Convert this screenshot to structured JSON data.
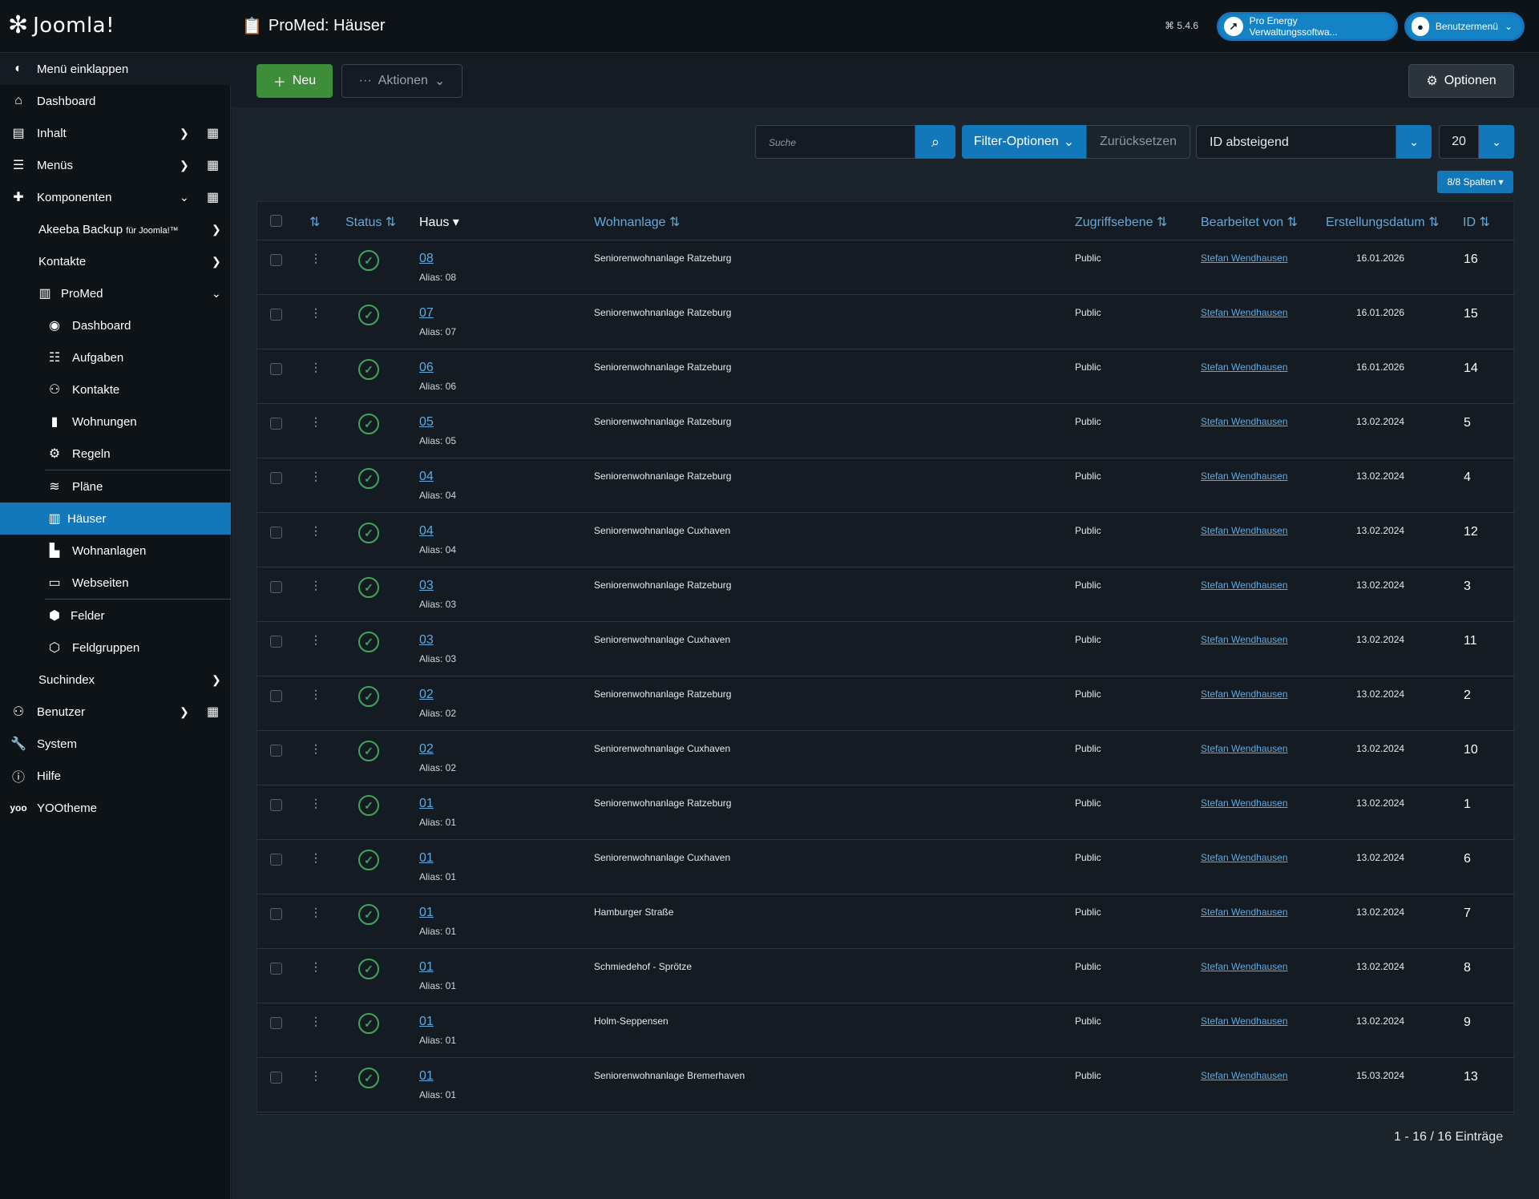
{
  "header": {
    "logo_text": "Joomla!",
    "title": "ProMed: Häuser",
    "version": "⌘ 5.4.6",
    "site_link": "Pro Energy Verwaltungssoftwa...",
    "user_menu": "Benutzermenü"
  },
  "sidebar": {
    "collapse": "Menü einklappen",
    "dashboard": "Dashboard",
    "inhalt": "Inhalt",
    "menus": "Menüs",
    "komponenten": "Komponenten",
    "akeeba": "Akeeba Backup",
    "akeeba_suffix": "für Joomla!™",
    "kontakte": "Kontakte",
    "promed": "ProMed",
    "pm_dashboard": "Dashboard",
    "pm_aufgaben": "Aufgaben",
    "pm_kontakte": "Kontakte",
    "pm_wohnungen": "Wohnungen",
    "pm_regeln": "Regeln",
    "pm_plaene": "Pläne",
    "pm_haeuser": "Häuser",
    "pm_wohnanlagen": "Wohnanlagen",
    "pm_webseiten": "Webseiten",
    "pm_felder": "Felder",
    "pm_feldgruppen": "Feldgruppen",
    "suchindex": "Suchindex",
    "benutzer": "Benutzer",
    "system": "System",
    "hilfe": "Hilfe",
    "yootheme": "YOOtheme"
  },
  "toolbar": {
    "new": "Neu",
    "actions": "Aktionen",
    "options": "Optionen"
  },
  "filters": {
    "search_placeholder": "Suche",
    "filter_options": "Filter-Optionen",
    "reset": "Zurücksetzen",
    "sort": "ID absteigend",
    "limit": "20",
    "columns": "8/8 Spalten"
  },
  "table": {
    "headers": {
      "status": "Status",
      "haus": "Haus",
      "wohnanlage": "Wohnanlage",
      "zugriff": "Zugriffsebene",
      "bearbeitet": "Bearbeitet von",
      "datum": "Erstellungsdatum",
      "id": "ID"
    },
    "rows": [
      {
        "haus": "08",
        "alias": "Alias: 08",
        "wohnanlage": "Seniorenwohnanlage Ratzeburg",
        "zugriff": "Public",
        "autor": "Stefan Wendhausen",
        "datum": "16.01.2026",
        "id": "16"
      },
      {
        "haus": "07",
        "alias": "Alias: 07",
        "wohnanlage": "Seniorenwohnanlage Ratzeburg",
        "zugriff": "Public",
        "autor": "Stefan Wendhausen",
        "datum": "16.01.2026",
        "id": "15"
      },
      {
        "haus": "06",
        "alias": "Alias: 06",
        "wohnanlage": "Seniorenwohnanlage Ratzeburg",
        "zugriff": "Public",
        "autor": "Stefan Wendhausen",
        "datum": "16.01.2026",
        "id": "14"
      },
      {
        "haus": "05",
        "alias": "Alias: 05",
        "wohnanlage": "Seniorenwohnanlage Ratzeburg",
        "zugriff": "Public",
        "autor": "Stefan Wendhausen",
        "datum": "13.02.2024",
        "id": "5"
      },
      {
        "haus": "04",
        "alias": "Alias: 04",
        "wohnanlage": "Seniorenwohnanlage Ratzeburg",
        "zugriff": "Public",
        "autor": "Stefan Wendhausen",
        "datum": "13.02.2024",
        "id": "4"
      },
      {
        "haus": "04",
        "alias": "Alias: 04",
        "wohnanlage": "Seniorenwohnanlage Cuxhaven",
        "zugriff": "Public",
        "autor": "Stefan Wendhausen",
        "datum": "13.02.2024",
        "id": "12"
      },
      {
        "haus": "03",
        "alias": "Alias: 03",
        "wohnanlage": "Seniorenwohnanlage Ratzeburg",
        "zugriff": "Public",
        "autor": "Stefan Wendhausen",
        "datum": "13.02.2024",
        "id": "3"
      },
      {
        "haus": "03",
        "alias": "Alias: 03",
        "wohnanlage": "Seniorenwohnanlage Cuxhaven",
        "zugriff": "Public",
        "autor": "Stefan Wendhausen",
        "datum": "13.02.2024",
        "id": "11"
      },
      {
        "haus": "02",
        "alias": "Alias: 02",
        "wohnanlage": "Seniorenwohnanlage Ratzeburg",
        "zugriff": "Public",
        "autor": "Stefan Wendhausen",
        "datum": "13.02.2024",
        "id": "2"
      },
      {
        "haus": "02",
        "alias": "Alias: 02",
        "wohnanlage": "Seniorenwohnanlage Cuxhaven",
        "zugriff": "Public",
        "autor": "Stefan Wendhausen",
        "datum": "13.02.2024",
        "id": "10"
      },
      {
        "haus": "01",
        "alias": "Alias: 01",
        "wohnanlage": "Seniorenwohnanlage Ratzeburg",
        "zugriff": "Public",
        "autor": "Stefan Wendhausen",
        "datum": "13.02.2024",
        "id": "1"
      },
      {
        "haus": "01",
        "alias": "Alias: 01",
        "wohnanlage": "Seniorenwohnanlage Cuxhaven",
        "zugriff": "Public",
        "autor": "Stefan Wendhausen",
        "datum": "13.02.2024",
        "id": "6"
      },
      {
        "haus": "01",
        "alias": "Alias: 01",
        "wohnanlage": "Hamburger Straße",
        "zugriff": "Public",
        "autor": "Stefan Wendhausen",
        "datum": "13.02.2024",
        "id": "7"
      },
      {
        "haus": "01",
        "alias": "Alias: 01",
        "wohnanlage": "Schmiedehof - Sprötze",
        "zugriff": "Public",
        "autor": "Stefan Wendhausen",
        "datum": "13.02.2024",
        "id": "8"
      },
      {
        "haus": "01",
        "alias": "Alias: 01",
        "wohnanlage": "Holm-Seppensen",
        "zugriff": "Public",
        "autor": "Stefan Wendhausen",
        "datum": "13.02.2024",
        "id": "9"
      },
      {
        "haus": "01",
        "alias": "Alias: 01",
        "wohnanlage": "Seniorenwohnanlage Bremerhaven",
        "zugriff": "Public",
        "autor": "Stefan Wendhausen",
        "datum": "15.03.2024",
        "id": "13"
      }
    ]
  },
  "pagination": "1 - 16 / 16 Einträge"
}
